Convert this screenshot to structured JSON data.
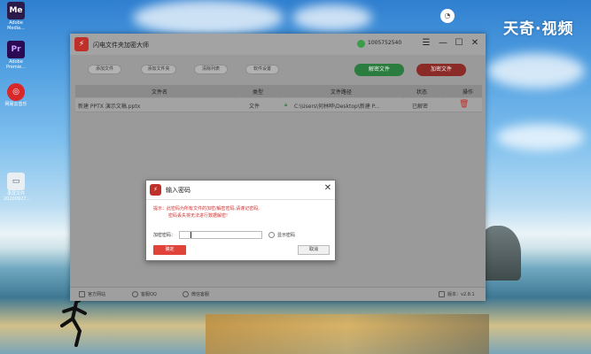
{
  "desktop": {
    "icons": [
      {
        "label": "Adobe Media...",
        "glyph": "Me",
        "color": "#2b1a4a"
      },
      {
        "label": "Adobe Premie...",
        "glyph": "Pr",
        "color": "#2a0a52"
      },
      {
        "label": "网易云音乐",
        "glyph": "◎",
        "color": "#d8282a"
      },
      {
        "label": "录屏文件 20200927...",
        "glyph": "▭",
        "color": "#4a5a6a"
      }
    ],
    "watermark": "天奇·视频"
  },
  "app": {
    "title": "闪电文件夹加密大师",
    "user_id": "1005752540",
    "window_controls": {
      "menu": "☰",
      "minimize": "—",
      "maximize": "☐",
      "close": "✕"
    },
    "toolbar": {
      "add_file": "添加文件",
      "add_folder": "添加文件夹",
      "clear_list": "清除列表",
      "settings": "软件设置",
      "decrypt": "解密文件",
      "encrypt": "加密文件"
    },
    "table": {
      "columns": [
        "文件名",
        "类型",
        "文件路径",
        "状态",
        "操作"
      ],
      "rows": [
        {
          "name": "新建 PPTX 演示文稿.pptx",
          "type": "文件",
          "path": "C:\\Users\\何林晔\\Desktop\\新建 P...",
          "status": "已解密"
        }
      ]
    },
    "statusbar": {
      "website": "官方网站",
      "qq": "客服QQ",
      "wechat": "微信客服",
      "version": "版本：v2.8.1"
    }
  },
  "dialog": {
    "title": "输入密码",
    "hint_line1": "提示：此密码为所有文件的加密/解密密码,请谨记密码,",
    "hint_line2": "密码丢失将无法进行数据解密!",
    "password_label": "加密密码：",
    "password_value": "",
    "show_password_label": "显示密码",
    "ok": "确定",
    "cancel": "取消"
  }
}
